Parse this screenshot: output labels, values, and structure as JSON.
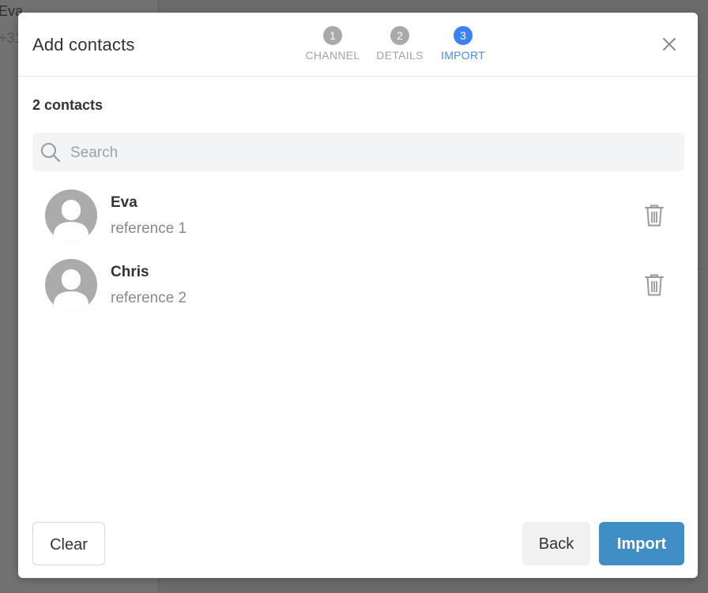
{
  "background": {
    "contact_name": "Eva",
    "contact_phone": "+31"
  },
  "modal": {
    "title": "Add contacts",
    "steps": [
      {
        "number": "1",
        "label": "CHANNEL",
        "state": "done"
      },
      {
        "number": "2",
        "label": "DETAILS",
        "state": "done"
      },
      {
        "number": "3",
        "label": "IMPORT",
        "state": "active"
      }
    ],
    "count_label": "2 contacts",
    "search": {
      "placeholder": "Search",
      "value": ""
    },
    "contacts": [
      {
        "name": "Eva",
        "reference": "reference 1"
      },
      {
        "name": "Chris",
        "reference": "reference 2"
      }
    ],
    "buttons": {
      "clear": "Clear",
      "back": "Back",
      "import": "Import"
    }
  },
  "colors": {
    "accent": "#3b82f6",
    "primary_button": "#3f8fc6",
    "step_inactive": "#a9a9a9"
  },
  "icons": {
    "close": "close-icon",
    "search": "search-icon",
    "avatar": "user-avatar-icon",
    "delete": "trash-icon"
  }
}
